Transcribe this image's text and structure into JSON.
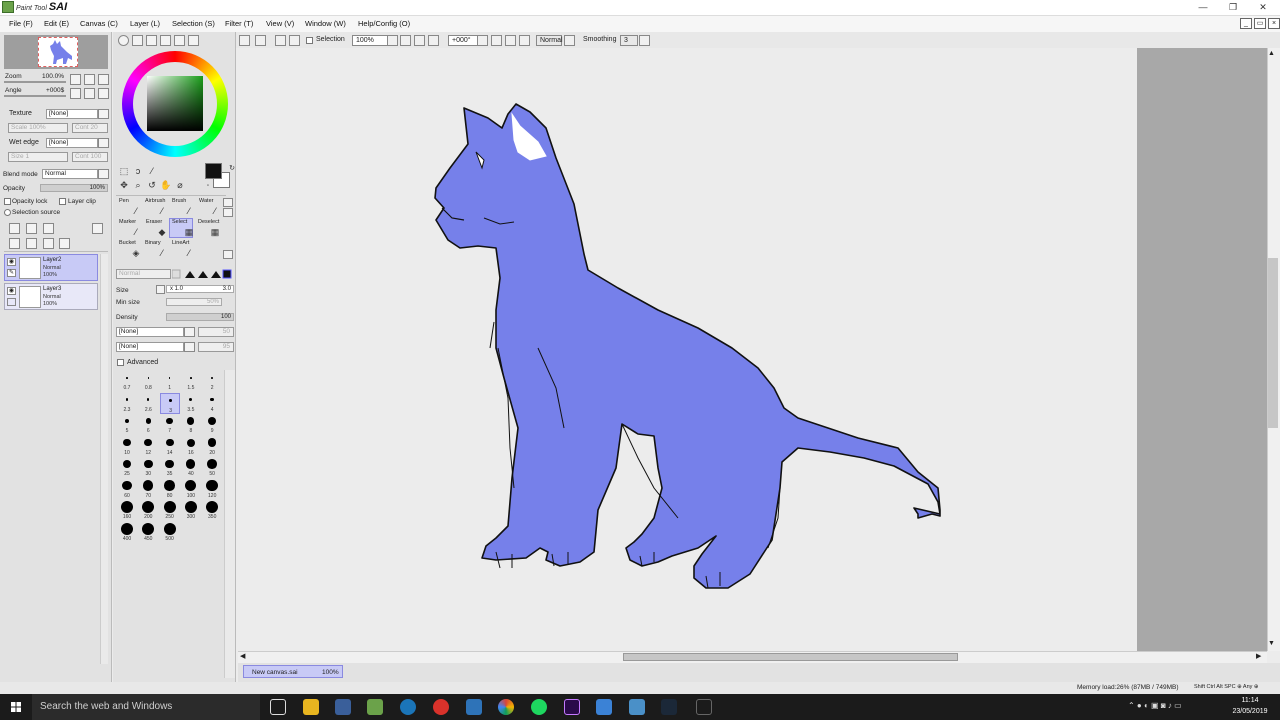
{
  "app": {
    "logo_small": "Paint Tool",
    "logo_big": "SAI"
  },
  "window_controls": {
    "minimize": "—",
    "maximize": "❐",
    "close": "✕"
  },
  "menu": [
    "File (F)",
    "Edit (E)",
    "Canvas (C)",
    "Layer (L)",
    "Selection (S)",
    "Filter (T)",
    "View (V)",
    "Window (W)",
    "Help/Config (O)"
  ],
  "toolbar": {
    "selection_label": "Selection",
    "zoom_value": "100%",
    "angle_value": "+000°",
    "blend_value": "Normal",
    "smoothing_label": "Smoothing",
    "smoothing_value": "3"
  },
  "navigator": {
    "zoom_label": "Zoom",
    "zoom_value": "100.0%",
    "angle_label": "Angle",
    "angle_value": "+000$"
  },
  "texture": {
    "label": "Texture",
    "value": "[None]",
    "scale_label": "Scale",
    "scale_value": "100%",
    "cont_label": "Cont",
    "cont_value": "20"
  },
  "wet_edge": {
    "label": "Wet edge",
    "value": "[None]",
    "size_label": "Size",
    "size_value": "1",
    "cont_label": "Cont",
    "cont_value": "100"
  },
  "blend": {
    "label": "Blend mode",
    "value": "Normal"
  },
  "opacity": {
    "label": "Opacity",
    "value": "100%"
  },
  "checks": {
    "opacity_lock": "Opacity lock",
    "layer_clip": "Layer clip",
    "selection_source": "Selection source"
  },
  "layers": [
    {
      "name": "Layer2",
      "mode": "Normal",
      "opacity": "100%",
      "selected": true
    },
    {
      "name": "Layer3",
      "mode": "Normal",
      "opacity": "100%",
      "selected": false
    }
  ],
  "tools": {
    "row1": [
      "Pen",
      "Airbrush",
      "Brush",
      "Water"
    ],
    "row2": [
      "Marker",
      "Eraser",
      "Select",
      "Deselect"
    ],
    "row3": [
      "Bucket",
      "Binary",
      "LineArt"
    ]
  },
  "brush": {
    "mode": "Normal",
    "size_label": "Size",
    "size_mult": "x 1.0",
    "size_value": "3.0",
    "min_size_label": "Min size",
    "min_size_value": "50%",
    "density_label": "Density",
    "density_value": "100",
    "shape1": "[None]",
    "shape1_val": "50",
    "shape2": "[None]",
    "shape2_val": "95",
    "advanced_label": "Advanced"
  },
  "brush_sizes": [
    "0.7",
    "0.8",
    "1",
    "1.5",
    "2",
    "2.3",
    "2.6",
    "3",
    "3.5",
    "4",
    "5",
    "6",
    "7",
    "8",
    "9",
    "10",
    "12",
    "14",
    "16",
    "20",
    "25",
    "30",
    "35",
    "40",
    "50",
    "60",
    "70",
    "80",
    "100",
    "120",
    "160",
    "200",
    "250",
    "300",
    "350",
    "400",
    "450",
    "500"
  ],
  "selected_brush_size": "3",
  "document": {
    "tab_name": "New canvas.sai",
    "tab_zoom": "100%"
  },
  "status": {
    "memory": "Memory load:26% (87MB / 749MB)",
    "keys": "Shift Ctrl Alt SPC ⊕ Any ⊕"
  },
  "taskbar": {
    "search_placeholder": "Search the web and Windows",
    "time": "11:14",
    "date": "23/05/2019"
  },
  "colors": {
    "cat_fill": "#7680ea",
    "cat_line": "#111111",
    "foreground": "#111111",
    "background": "#ffffff",
    "selection": "#c8caf6"
  }
}
